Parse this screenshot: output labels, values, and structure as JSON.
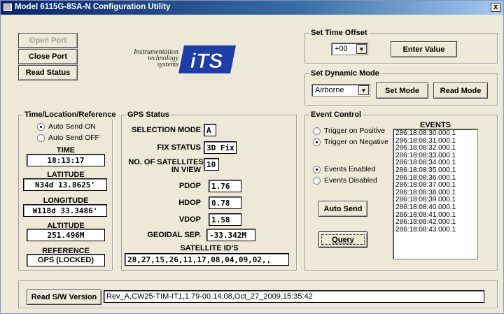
{
  "window": {
    "title": "Model 6115G-8SA-N Configuration Utility",
    "close_glyph": "x"
  },
  "port_buttons": {
    "open_port": "Open Port",
    "close_port": "Close Port",
    "read_status": "Read Status"
  },
  "logo": {
    "line1": "Instrumentation",
    "line2": "technology",
    "line3": "systems",
    "mark": "iTS"
  },
  "time_offset": {
    "legend": "Set Time Offset",
    "selected": "+00",
    "enter_button": "Enter Value"
  },
  "dynamic_mode": {
    "legend": "Set Dynamic Mode",
    "selected": "Airborne",
    "set_button": "Set Mode",
    "read_button": "Read Mode"
  },
  "time_location": {
    "legend": "Time/Location/Reference",
    "auto_on": "Auto Send ON",
    "auto_off": "Auto Send OFF",
    "auto_selected": "on",
    "time_label": "TIME",
    "time_value": "18:13:17",
    "latitude_label": "LATITUDE",
    "latitude_value": "N34d 13.8625'",
    "longitude_label": "LONGITUDE",
    "longitude_value": "W118d 33.3486'",
    "altitude_label": "ALTITUDE",
    "altitude_value": "251.496M",
    "reference_label": "REFERENCE",
    "reference_value": "GPS (LOCKED)"
  },
  "gps_status": {
    "legend": "GPS Status",
    "selection_mode_label": "SELECTION MODE",
    "selection_mode_value": "A",
    "fix_status_label": "FIX STATUS",
    "fix_status_value": "3D Fix",
    "satellites_label_line1": "NO. OF SATELLITES",
    "satellites_label_line2": "IN VIEW",
    "satellites_value": "10",
    "pdop_label": "PDOP",
    "pdop_value": "1.76",
    "hdop_label": "HDOP",
    "hdop_value": "0.78",
    "vdop_label": "VDOP",
    "vdop_value": "1.58",
    "geoidal_label": "GEOIDAL SEP.",
    "geoidal_value": "-33.342M",
    "satellite_ids_label": "SATELLITE ID'S",
    "satellite_ids_value": "28,27,15,26,11,17,08,04,09,02,,"
  },
  "event_control": {
    "legend": "Event Control",
    "trigger_positive": "Trigger on Positive",
    "trigger_negative": "Trigger on Negative",
    "trigger_selected": "negative",
    "events_enabled": "Events Enabled",
    "events_disabled": "Events Disabled",
    "events_selected": "enabled",
    "auto_send_button": "Auto Send",
    "query_button": "Query",
    "events_label": "EVENTS",
    "events": [
      "286:18:08:30.000.1",
      "286:18:08:31.000.1",
      "286:18:08:32.000.1",
      "286:18:08:33.000.1",
      "286:18:08:34.000.1",
      "286:18:08:35.000.1",
      "286:18:08:36.000.1",
      "286:18:08:37.000.1",
      "286:18:08:38.000.1",
      "286:18:08:39.000.1",
      "286:18:08:40.000.1",
      "286:18:08:41.000.1",
      "286:18:08:42.000.1",
      "286:18:08:43.000.1"
    ]
  },
  "version": {
    "read_button": "Read S/W Version",
    "value": "Rev_A,CW25-TIM-IT1,1.79-00.14.08,Oct_27_2009,15:35:42"
  }
}
